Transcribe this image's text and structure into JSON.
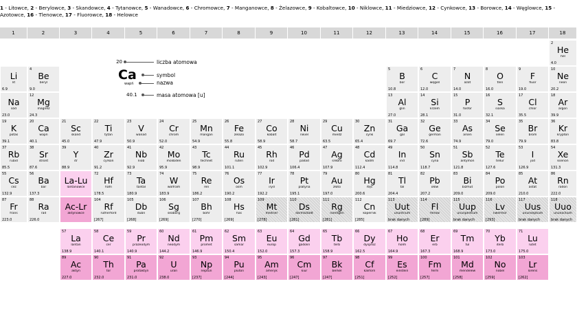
{
  "legend_groups": [
    {
      "num": "1",
      "name": "Litowce"
    },
    {
      "num": "2",
      "name": "Berylowce"
    },
    {
      "num": "3",
      "name": "Skandowce"
    },
    {
      "num": "4",
      "name": "Tytanowce"
    },
    {
      "num": "5",
      "name": "Wanadowce"
    },
    {
      "num": "6",
      "name": "Chromowce"
    },
    {
      "num": "7",
      "name": "Manganowce"
    },
    {
      "num": "8",
      "name": "Żelazowce"
    },
    {
      "num": "9",
      "name": "Kobaltowce"
    },
    {
      "num": "10",
      "name": "Niklowce"
    },
    {
      "num": "11",
      "name": "Miedziowce"
    },
    {
      "num": "12",
      "name": "Cynkowce"
    },
    {
      "num": "13",
      "name": "Borowce"
    },
    {
      "num": "14",
      "name": "Węglowce"
    },
    {
      "num": "15",
      "name": "Azotowce"
    },
    {
      "num": "16",
      "name": "Tlenowce"
    },
    {
      "num": "17",
      "name": "Fluorowce"
    },
    {
      "num": "18",
      "name": "Helowce"
    }
  ],
  "column_headers": [
    "1",
    "2",
    "3",
    "4",
    "5",
    "6",
    "7",
    "8",
    "9",
    "10",
    "11",
    "12",
    "13",
    "14",
    "15",
    "16",
    "17",
    "18"
  ],
  "key": {
    "z": "20",
    "symbol": "Ca",
    "name": "wapń",
    "mass": "40.1",
    "label_z": "liczba atomowa",
    "label_symbol": "symbol",
    "label_name": "nazwa",
    "label_mass": "masa atomowa [u]"
  },
  "elements": [
    {
      "z": "2",
      "sym": "He",
      "name": "hel",
      "mass": "4.0",
      "col": 18,
      "row": 1
    },
    {
      "z": "",
      "sym": "Li",
      "name": "lit",
      "mass": "6.9",
      "col": 1,
      "row": 2
    },
    {
      "z": "4",
      "sym": "Be",
      "name": "beryl",
      "mass": "9.0",
      "col": 2,
      "row": 2
    },
    {
      "z": "5",
      "sym": "B",
      "name": "bor",
      "mass": "10.8",
      "col": 13,
      "row": 2
    },
    {
      "z": "6",
      "sym": "C",
      "name": "węgiel",
      "mass": "12.0",
      "col": 14,
      "row": 2
    },
    {
      "z": "7",
      "sym": "N",
      "name": "azot",
      "mass": "14.0",
      "col": 15,
      "row": 2
    },
    {
      "z": "8",
      "sym": "O",
      "name": "tlen",
      "mass": "16.0",
      "col": 16,
      "row": 2
    },
    {
      "z": "9",
      "sym": "F",
      "name": "fluor",
      "mass": "19.0",
      "col": 17,
      "row": 2
    },
    {
      "z": "10",
      "sym": "Ne",
      "name": "neon",
      "mass": "20.2",
      "col": 18,
      "row": 2
    },
    {
      "z": "",
      "sym": "Na",
      "name": "sód",
      "mass": "23.0",
      "col": 1,
      "row": 3
    },
    {
      "z": "12",
      "sym": "Mg",
      "name": "magnez",
      "mass": "24.3",
      "col": 2,
      "row": 3
    },
    {
      "z": "13",
      "sym": "Al",
      "name": "glin",
      "mass": "27.0",
      "col": 13,
      "row": 3
    },
    {
      "z": "14",
      "sym": "Si",
      "name": "krzem",
      "mass": "28.1",
      "col": 14,
      "row": 3
    },
    {
      "z": "15",
      "sym": "P",
      "name": "fosfor",
      "mass": "31.0",
      "col": 15,
      "row": 3
    },
    {
      "z": "16",
      "sym": "S",
      "name": "siarka",
      "mass": "32.1",
      "col": 16,
      "row": 3
    },
    {
      "z": "17",
      "sym": "Cl",
      "name": "chlor",
      "mass": "35.5",
      "col": 17,
      "row": 3
    },
    {
      "z": "18",
      "sym": "Ar",
      "name": "argon",
      "mass": "39.9",
      "col": 18,
      "row": 3
    },
    {
      "z": "19",
      "sym": "K",
      "name": "potas",
      "mass": "39.1",
      "col": 1,
      "row": 4
    },
    {
      "z": "20",
      "sym": "Ca",
      "name": "wapń",
      "mass": "40.1",
      "col": 2,
      "row": 4
    },
    {
      "z": "21",
      "sym": "Sc",
      "name": "skand",
      "mass": "45.0",
      "col": 3,
      "row": 4
    },
    {
      "z": "22",
      "sym": "Ti",
      "name": "tytan",
      "mass": "47.9",
      "col": 4,
      "row": 4
    },
    {
      "z": "23",
      "sym": "V",
      "name": "wanad",
      "mass": "50.9",
      "col": 5,
      "row": 4
    },
    {
      "z": "24",
      "sym": "Cr",
      "name": "chrom",
      "mass": "52.0",
      "col": 6,
      "row": 4
    },
    {
      "z": "25",
      "sym": "Mn",
      "name": "mangan",
      "mass": "54.9",
      "col": 7,
      "row": 4
    },
    {
      "z": "26",
      "sym": "Fe",
      "name": "żelazo",
      "mass": "55.8",
      "col": 8,
      "row": 4
    },
    {
      "z": "27",
      "sym": "Co",
      "name": "kobalt",
      "mass": "58.9",
      "col": 9,
      "row": 4
    },
    {
      "z": "28",
      "sym": "Ni",
      "name": "nikiel",
      "mass": "58.7",
      "col": 10,
      "row": 4
    },
    {
      "z": "29",
      "sym": "Cu",
      "name": "miedź",
      "mass": "63.5",
      "col": 11,
      "row": 4
    },
    {
      "z": "30",
      "sym": "Zn",
      "name": "cynk",
      "mass": "65.4",
      "col": 12,
      "row": 4
    },
    {
      "z": "31",
      "sym": "Ga",
      "name": "gal",
      "mass": "69.7",
      "col": 13,
      "row": 4
    },
    {
      "z": "32",
      "sym": "Ge",
      "name": "german",
      "mass": "72.6",
      "col": 14,
      "row": 4
    },
    {
      "z": "33",
      "sym": "As",
      "name": "arsen",
      "mass": "74.9",
      "col": 15,
      "row": 4
    },
    {
      "z": "34",
      "sym": "Se",
      "name": "selen",
      "mass": "79.0",
      "col": 16,
      "row": 4
    },
    {
      "z": "35",
      "sym": "Br",
      "name": "brom",
      "mass": "79.9",
      "col": 17,
      "row": 4
    },
    {
      "z": "36",
      "sym": "Kr",
      "name": "krypton",
      "mass": "83.8",
      "col": 18,
      "row": 4
    },
    {
      "z": "37",
      "sym": "Rb",
      "name": "rubid",
      "mass": "85.5",
      "col": 1,
      "row": 5
    },
    {
      "z": "38",
      "sym": "Sr",
      "name": "stront",
      "mass": "87.6",
      "col": 2,
      "row": 5
    },
    {
      "z": "39",
      "sym": "Y",
      "name": "itr",
      "mass": "88.9",
      "col": 3,
      "row": 5
    },
    {
      "z": "40",
      "sym": "Zr",
      "name": "cyrkon",
      "mass": "91.2",
      "col": 4,
      "row": 5
    },
    {
      "z": "41",
      "sym": "Nb",
      "name": "niob",
      "mass": "92.9",
      "col": 5,
      "row": 5
    },
    {
      "z": "42",
      "sym": "Mo",
      "name": "molibden",
      "mass": "95.9",
      "col": 6,
      "row": 5
    },
    {
      "z": "43",
      "sym": "Tc",
      "name": "technet",
      "mass": "98.9",
      "col": 7,
      "row": 5
    },
    {
      "z": "44",
      "sym": "Ru",
      "name": "ruten",
      "mass": "101.1",
      "col": 8,
      "row": 5
    },
    {
      "z": "45",
      "sym": "Rh",
      "name": "rod",
      "mass": "102.9",
      "col": 9,
      "row": 5
    },
    {
      "z": "46",
      "sym": "Pd",
      "name": "pallad",
      "mass": "106.4",
      "col": 10,
      "row": 5
    },
    {
      "z": "47",
      "sym": "Ag",
      "name": "srebro",
      "mass": "107.9",
      "col": 11,
      "row": 5
    },
    {
      "z": "48",
      "sym": "Cd",
      "name": "kadm",
      "mass": "112.4",
      "col": 12,
      "row": 5
    },
    {
      "z": "49",
      "sym": "In",
      "name": "ind",
      "mass": "114.8",
      "col": 13,
      "row": 5
    },
    {
      "z": "50",
      "sym": "Sn",
      "name": "cyna",
      "mass": "118.7",
      "col": 14,
      "row": 5
    },
    {
      "z": "51",
      "sym": "Sb",
      "name": "antymon",
      "mass": "121.8",
      "col": 15,
      "row": 5
    },
    {
      "z": "52",
      "sym": "Te",
      "name": "tellur",
      "mass": "127.6",
      "col": 16,
      "row": 5
    },
    {
      "z": "53",
      "sym": "I",
      "name": "jod",
      "mass": "126.9",
      "col": 17,
      "row": 5
    },
    {
      "z": "54",
      "sym": "Xe",
      "name": "ksenon",
      "mass": "131.3",
      "col": 18,
      "row": 5
    },
    {
      "z": "55",
      "sym": "Cs",
      "name": "cez",
      "mass": "132.9",
      "col": 1,
      "row": 6
    },
    {
      "z": "56",
      "sym": "Ba",
      "name": "bar",
      "mass": "137.3",
      "col": 2,
      "row": 6
    },
    {
      "z": "",
      "sym": "La-Lu",
      "name": "lantanowce",
      "mass": "",
      "col": 3,
      "row": 6,
      "kind": "lanthanoid"
    },
    {
      "z": "72",
      "sym": "Hf",
      "name": "hafn",
      "mass": "178.5",
      "col": 4,
      "row": 6
    },
    {
      "z": "73",
      "sym": "Ta",
      "name": "tantal",
      "mass": "180.9",
      "col": 5,
      "row": 6
    },
    {
      "z": "74",
      "sym": "W",
      "name": "wolfram",
      "mass": "183.9",
      "col": 6,
      "row": 6
    },
    {
      "z": "75",
      "sym": "Re",
      "name": "ren",
      "mass": "186.2",
      "col": 7,
      "row": 6
    },
    {
      "z": "76",
      "sym": "Os",
      "name": "osm",
      "mass": "190.2",
      "col": 8,
      "row": 6
    },
    {
      "z": "77",
      "sym": "Ir",
      "name": "iryd",
      "mass": "192.2",
      "col": 9,
      "row": 6
    },
    {
      "z": "78",
      "sym": "Pt",
      "name": "platyna",
      "mass": "195.1",
      "col": 10,
      "row": 6
    },
    {
      "z": "79",
      "sym": "Au",
      "name": "złoto",
      "mass": "197.0",
      "col": 11,
      "row": 6
    },
    {
      "z": "80",
      "sym": "Hg",
      "name": "rtęć",
      "mass": "200.6",
      "col": 12,
      "row": 6
    },
    {
      "z": "81",
      "sym": "Tl",
      "name": "tal",
      "mass": "204.4",
      "col": 13,
      "row": 6
    },
    {
      "z": "82",
      "sym": "Pb",
      "name": "ołów",
      "mass": "207.2",
      "col": 14,
      "row": 6
    },
    {
      "z": "83",
      "sym": "Bi",
      "name": "bizmut",
      "mass": "209.0",
      "col": 15,
      "row": 6
    },
    {
      "z": "84",
      "sym": "Po",
      "name": "polon",
      "mass": "209.0",
      "col": 16,
      "row": 6
    },
    {
      "z": "85",
      "sym": "At",
      "name": "astat",
      "mass": "210.0",
      "col": 17,
      "row": 6
    },
    {
      "z": "86",
      "sym": "Rn",
      "name": "radon",
      "mass": "222.0",
      "col": 18,
      "row": 6
    },
    {
      "z": "87",
      "sym": "Fr",
      "name": "frans",
      "mass": "223.0",
      "col": 1,
      "row": 7
    },
    {
      "z": "88",
      "sym": "Ra",
      "name": "rad",
      "mass": "226.0",
      "col": 2,
      "row": 7
    },
    {
      "z": "",
      "sym": "Ac-Lr",
      "name": "aktynowce",
      "mass": "",
      "col": 3,
      "row": 7,
      "kind": "actinoid"
    },
    {
      "z": "104",
      "sym": "Rf",
      "name": "rutherford",
      "mass": "[267]",
      "col": 4,
      "row": 7
    },
    {
      "z": "105",
      "sym": "Db",
      "name": "dubn",
      "mass": "[268]",
      "col": 5,
      "row": 7
    },
    {
      "z": "106",
      "sym": "Sg",
      "name": "seaborg",
      "mass": "[269]",
      "col": 6,
      "row": 7
    },
    {
      "z": "107",
      "sym": "Bh",
      "name": "bohr",
      "mass": "[270]",
      "col": 7,
      "row": 7
    },
    {
      "z": "108",
      "sym": "Hs",
      "name": "has",
      "mass": "[269]",
      "col": 8,
      "row": 7
    },
    {
      "z": "109",
      "sym": "Mt",
      "name": "meitner",
      "mass": "[278]",
      "col": 9,
      "row": 7,
      "kind": "hatched"
    },
    {
      "z": "110",
      "sym": "Ds",
      "name": "darmsztadt",
      "mass": "[281]",
      "col": 10,
      "row": 7,
      "kind": "hatched"
    },
    {
      "z": "111",
      "sym": "Rg",
      "name": "roentgen",
      "mass": "[281]",
      "col": 11,
      "row": 7,
      "kind": "hatched"
    },
    {
      "z": "112",
      "sym": "Cn",
      "name": "kopernik",
      "mass": "[285]",
      "col": 12,
      "row": 7
    },
    {
      "z": "113",
      "sym": "Uut",
      "name": "ununtrium",
      "mass": "brak danych",
      "col": 13,
      "row": 7,
      "kind": "hatched"
    },
    {
      "z": "114",
      "sym": "Fl",
      "name": "flerow",
      "mass": "[289]",
      "col": 14,
      "row": 7,
      "kind": "hatched"
    },
    {
      "z": "115",
      "sym": "Uup",
      "name": "ununpentium",
      "mass": "brak danych",
      "col": 15,
      "row": 7,
      "kind": "hatched"
    },
    {
      "z": "116",
      "sym": "Lv",
      "name": "liwermor",
      "mass": "[293]",
      "col": 16,
      "row": 7,
      "kind": "hatched"
    },
    {
      "z": "117",
      "sym": "Uus",
      "name": "ununseptium",
      "mass": "brak danych",
      "col": 17,
      "row": 7,
      "kind": "hatched"
    },
    {
      "z": "118",
      "sym": "Uuo",
      "name": "ununoctium",
      "mass": "brak danych",
      "col": 18,
      "row": 7,
      "kind": "hatched"
    },
    {
      "z": "57",
      "sym": "La",
      "name": "lantan",
      "mass": "138.9",
      "col": 3,
      "row": 9,
      "kind": "lanthanoid"
    },
    {
      "z": "58",
      "sym": "Ce",
      "name": "cer",
      "mass": "140.1",
      "col": 4,
      "row": 9,
      "kind": "lanthanoid"
    },
    {
      "z": "59",
      "sym": "Pr",
      "name": "prazeodym",
      "mass": "140.9",
      "col": 5,
      "row": 9,
      "kind": "lanthanoid"
    },
    {
      "z": "60",
      "sym": "Nd",
      "name": "neodym",
      "mass": "144.2",
      "col": 6,
      "row": 9,
      "kind": "lanthanoid"
    },
    {
      "z": "61",
      "sym": "Pm",
      "name": "promet",
      "mass": "146.9",
      "col": 7,
      "row": 9,
      "kind": "lanthanoid"
    },
    {
      "z": "62",
      "sym": "Sm",
      "name": "samar",
      "mass": "150.4",
      "col": 8,
      "row": 9,
      "kind": "lanthanoid"
    },
    {
      "z": "63",
      "sym": "Eu",
      "name": "europ",
      "mass": "152.0",
      "col": 9,
      "row": 9,
      "kind": "lanthanoid"
    },
    {
      "z": "64",
      "sym": "Gd",
      "name": "gadolin",
      "mass": "157.3",
      "col": 10,
      "row": 9,
      "kind": "lanthanoid"
    },
    {
      "z": "65",
      "sym": "Tb",
      "name": "terb",
      "mass": "158.9",
      "col": 11,
      "row": 9,
      "kind": "lanthanoid"
    },
    {
      "z": "66",
      "sym": "Dy",
      "name": "dysproz",
      "mass": "162.5",
      "col": 12,
      "row": 9,
      "kind": "lanthanoid"
    },
    {
      "z": "67",
      "sym": "Ho",
      "name": "holm",
      "mass": "164.9",
      "col": 13,
      "row": 9,
      "kind": "lanthanoid"
    },
    {
      "z": "68",
      "sym": "Er",
      "name": "erb",
      "mass": "167.3",
      "col": 14,
      "row": 9,
      "kind": "lanthanoid"
    },
    {
      "z": "69",
      "sym": "Tm",
      "name": "tul",
      "mass": "168.9",
      "col": 15,
      "row": 9,
      "kind": "lanthanoid"
    },
    {
      "z": "70",
      "sym": "Yb",
      "name": "iterb",
      "mass": "173.0",
      "col": 16,
      "row": 9,
      "kind": "lanthanoid"
    },
    {
      "z": "71",
      "sym": "Lu",
      "name": "lutet",
      "mass": "175.0",
      "col": 17,
      "row": 9,
      "kind": "lanthanoid"
    },
    {
      "z": "89",
      "sym": "Ac",
      "name": "aktyn",
      "mass": "227.0",
      "col": 3,
      "row": 10,
      "kind": "actinoid"
    },
    {
      "z": "90",
      "sym": "Th",
      "name": "tor",
      "mass": "232.0",
      "col": 4,
      "row": 10,
      "kind": "actinoid"
    },
    {
      "z": "91",
      "sym": "Pa",
      "name": "protaktyn",
      "mass": "231.0",
      "col": 5,
      "row": 10,
      "kind": "actinoid"
    },
    {
      "z": "92",
      "sym": "U",
      "name": "uran",
      "mass": "238.0",
      "col": 6,
      "row": 10,
      "kind": "actinoid"
    },
    {
      "z": "93",
      "sym": "Np",
      "name": "neptun",
      "mass": "[237]",
      "col": 7,
      "row": 10,
      "kind": "actinoid"
    },
    {
      "z": "94",
      "sym": "Pu",
      "name": "pluton",
      "mass": "[244]",
      "col": 8,
      "row": 10,
      "kind": "actinoid"
    },
    {
      "z": "95",
      "sym": "Am",
      "name": "ameryk",
      "mass": "[243]",
      "col": 9,
      "row": 10,
      "kind": "actinoid"
    },
    {
      "z": "96",
      "sym": "Cm",
      "name": "kiur",
      "mass": "[247]",
      "col": 10,
      "row": 10,
      "kind": "actinoid"
    },
    {
      "z": "97",
      "sym": "Bk",
      "name": "berkel",
      "mass": "[247]",
      "col": 11,
      "row": 10,
      "kind": "actinoid"
    },
    {
      "z": "98",
      "sym": "Cf",
      "name": "kaliforn",
      "mass": "[251]",
      "col": 12,
      "row": 10,
      "kind": "actinoid"
    },
    {
      "z": "99",
      "sym": "Es",
      "name": "einstein",
      "mass": "[252]",
      "col": 13,
      "row": 10,
      "kind": "actinoid"
    },
    {
      "z": "100",
      "sym": "Fm",
      "name": "ferm",
      "mass": "[257]",
      "col": 14,
      "row": 10,
      "kind": "actinoid"
    },
    {
      "z": "101",
      "sym": "Md",
      "name": "mendelew",
      "mass": "[258]",
      "col": 15,
      "row": 10,
      "kind": "actinoid"
    },
    {
      "z": "102",
      "sym": "No",
      "name": "nobel",
      "mass": "[259]",
      "col": 16,
      "row": 10,
      "kind": "actinoid"
    },
    {
      "z": "103",
      "sym": "Lr",
      "name": "lorens",
      "mass": "[262]",
      "col": 17,
      "row": 10,
      "kind": "actinoid"
    }
  ],
  "colors": {
    "lanthanoid": "#fbd0ee",
    "actinoid": "#f2a6d4",
    "default_cell": "#ededed",
    "header": "#d8d8d8"
  }
}
